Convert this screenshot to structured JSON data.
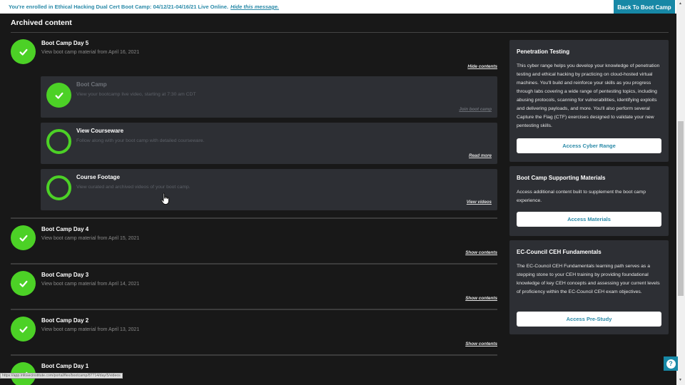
{
  "banner": {
    "text": "You're enrolled in Ethical Hacking Dual Cert Boot Camp: 04/12/21-04/16/21 Live Online.",
    "hide_link": "Hide this message.",
    "back_button": "Back To Boot Camp"
  },
  "page": {
    "title": "Archived content"
  },
  "days": [
    {
      "title": "Boot Camp Day 5",
      "subtitle": "View boot camp material from April 16, 2021",
      "toggle": "Hide contents",
      "completed": true,
      "items": [
        {
          "title": "Boot Camp",
          "description": "View your bootcamp live video, starting at 7:30 am CDT",
          "link": "Join boot camp",
          "completed": true
        },
        {
          "title": "View Courseware",
          "description": "Follow along with your boot camp with detailed courseware.",
          "link": "Read more",
          "completed": false
        },
        {
          "title": "Course Footage",
          "description": "View curated and archived videos of your boot camp.",
          "link": "View videos",
          "completed": false
        }
      ]
    },
    {
      "title": "Boot Camp Day 4",
      "subtitle": "View boot camp material from April 15, 2021",
      "toggle": "Show contents",
      "completed": true
    },
    {
      "title": "Boot Camp Day 3",
      "subtitle": "View boot camp material from April 14, 2021",
      "toggle": "Show contents",
      "completed": true
    },
    {
      "title": "Boot Camp Day 2",
      "subtitle": "View boot camp material from April 13, 2021",
      "toggle": "Show contents",
      "completed": true
    },
    {
      "title": "Boot Camp Day 1",
      "subtitle": "",
      "toggle": "",
      "completed": true
    }
  ],
  "sidebar": {
    "cards": [
      {
        "title": "Penetration Testing",
        "body": "This cyber range helps you develop your knowledge of penetration testing and ethical hacking by practicing on cloud-hosted virtual machines. You'll build and reinforce your skills as you progress through labs covering a wide range of pentesting topics, including abusing protocols, scanning for vulnerabilities, identifying exploits and delivering payloads, and more. You'll also perform several Capture the Flag (CTF) exercises designed to validate your new pentesting skills.",
        "button": "Access Cyber Range"
      },
      {
        "title": "Boot Camp Supporting Materials",
        "body": "Access additional content built to supplement the boot camp experience.",
        "button": "Access Materials"
      },
      {
        "title": "EC-Council CEH Fundamentals",
        "body": "The EC-Council CEH Fundamentals learning path serves as a stepping stone to your CEH training by providing foundational knowledge of key CEH concepts and assessing your current levels of proficiency within the EC-Council CEH exam objectives.",
        "button": "Access Pre-Study"
      }
    ]
  },
  "status_bar": {
    "url": "https://app.infosecinstitute.com/portal/flex/bootcamp/87714/day/5/videos"
  },
  "help": {
    "icon": "?"
  },
  "colors": {
    "accent": "#1788a6",
    "success": "#4cd126",
    "background": "#181818",
    "card": "#2d2f34"
  }
}
